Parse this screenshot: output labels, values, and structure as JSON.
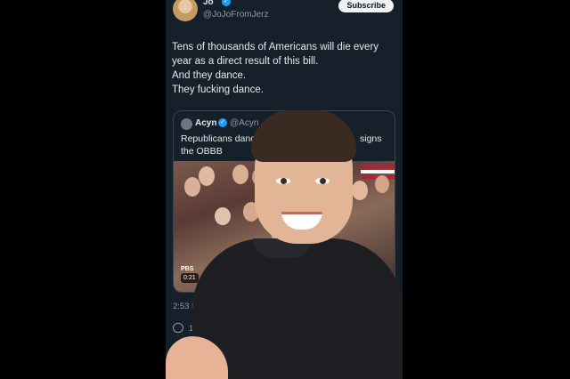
{
  "tweet": {
    "author_name": "Jo",
    "author_handle": "@JoJoFromJerz",
    "subscribe_label": "Subscribe",
    "text_lines": [
      "Tens of thousands of Americans will die every",
      "year as a direct result of this bill.",
      "And they dance.",
      "They fucking dance."
    ],
    "time": "2:53 PM",
    "reply_count": "1"
  },
  "quote": {
    "author_name": "Acyn",
    "author_handle": "@Acyn · 2h",
    "text_line1": "Republicans dancing",
    "text_line1b": "signs",
    "text_line2": "the OBBB",
    "media_badge": "PBS",
    "media_duration": "0:21"
  },
  "colors": {
    "background": "#15202b",
    "text": "#e7e9ea",
    "muted": "#8b98a5",
    "verified": "#1d9bf0"
  }
}
